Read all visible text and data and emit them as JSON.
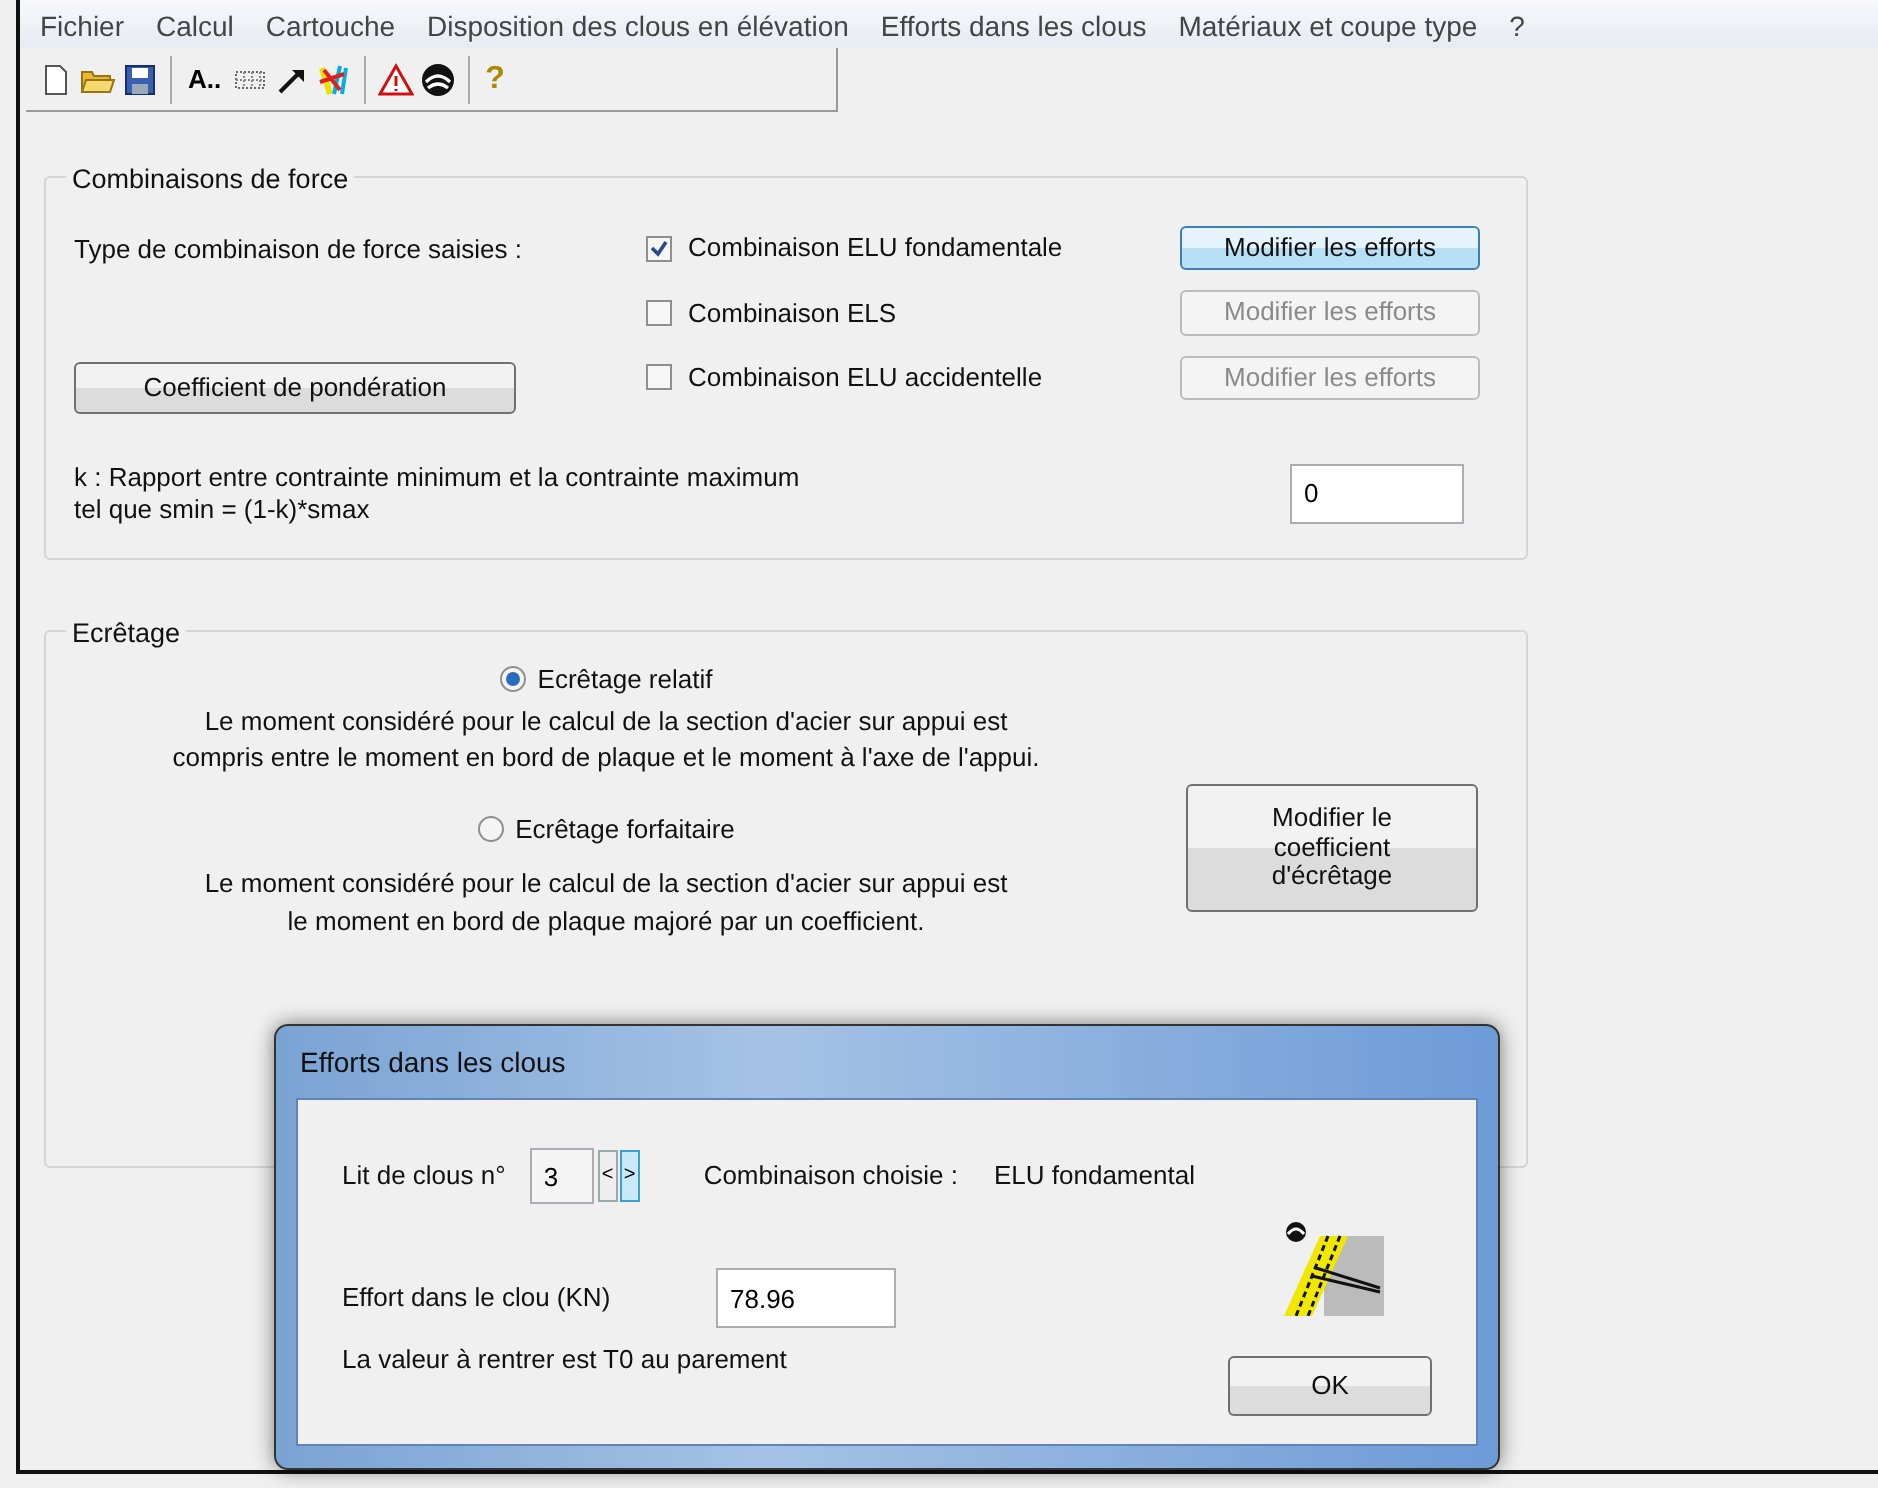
{
  "menu": [
    "Fichier",
    "Calcul",
    "Cartouche",
    "Disposition des clous en élévation",
    "Efforts dans les clous",
    "Matériaux et coupe type",
    "?"
  ],
  "toolbar": {
    "font_button": "A..",
    "help_button": "?"
  },
  "force_group": {
    "title": "Combinaisons de force",
    "type_label": "Type de combinaison de force saisies :",
    "combinations": [
      {
        "label": "Combinaison ELU fondamentale",
        "checked": true,
        "button": {
          "label": "Modifier les efforts",
          "disabled": false
        }
      },
      {
        "label": "Combinaison ELS",
        "checked": false,
        "button": {
          "label": "Modifier les efforts",
          "disabled": true
        }
      },
      {
        "label": "Combinaison ELU accidentelle",
        "checked": false,
        "button": {
          "label": "Modifier les efforts",
          "disabled": true
        }
      }
    ],
    "coef_button": "Coefficient de pondération",
    "k_text": "k : Rapport entre contrainte minimum et la contrainte maximum\ntel que smin = (1-k)*smax",
    "k_value": "0"
  },
  "ecretage": {
    "title": "Ecrêtage",
    "options": [
      {
        "label": "Ecrêtage relatif",
        "selected": true,
        "description": "Le moment considéré pour le calcul de la section d'acier sur appui est\ncompris entre le moment en bord de plaque et le moment à l'axe de l'appui."
      },
      {
        "label": "Ecrêtage forfaitaire",
        "selected": false,
        "description": "Le moment considéré pour le calcul de la section d'acier sur appui est\nle moment en bord de plaque majoré par un coefficient."
      }
    ],
    "button": "Modifier le\ncoefficient\nd'écrêtage"
  },
  "dialog": {
    "title": "Efforts dans les clous",
    "bed_label": "Lit de clous n°",
    "bed_value": "3",
    "prev": "<",
    "next": ">",
    "combination_label": "Combinaison choisie :",
    "combination_value": "ELU fondamental",
    "effort_label": "Effort dans le clou (KN)",
    "effort_value": "78.96",
    "note": "La valeur à rentrer est T0 au parement",
    "ok": "OK"
  }
}
